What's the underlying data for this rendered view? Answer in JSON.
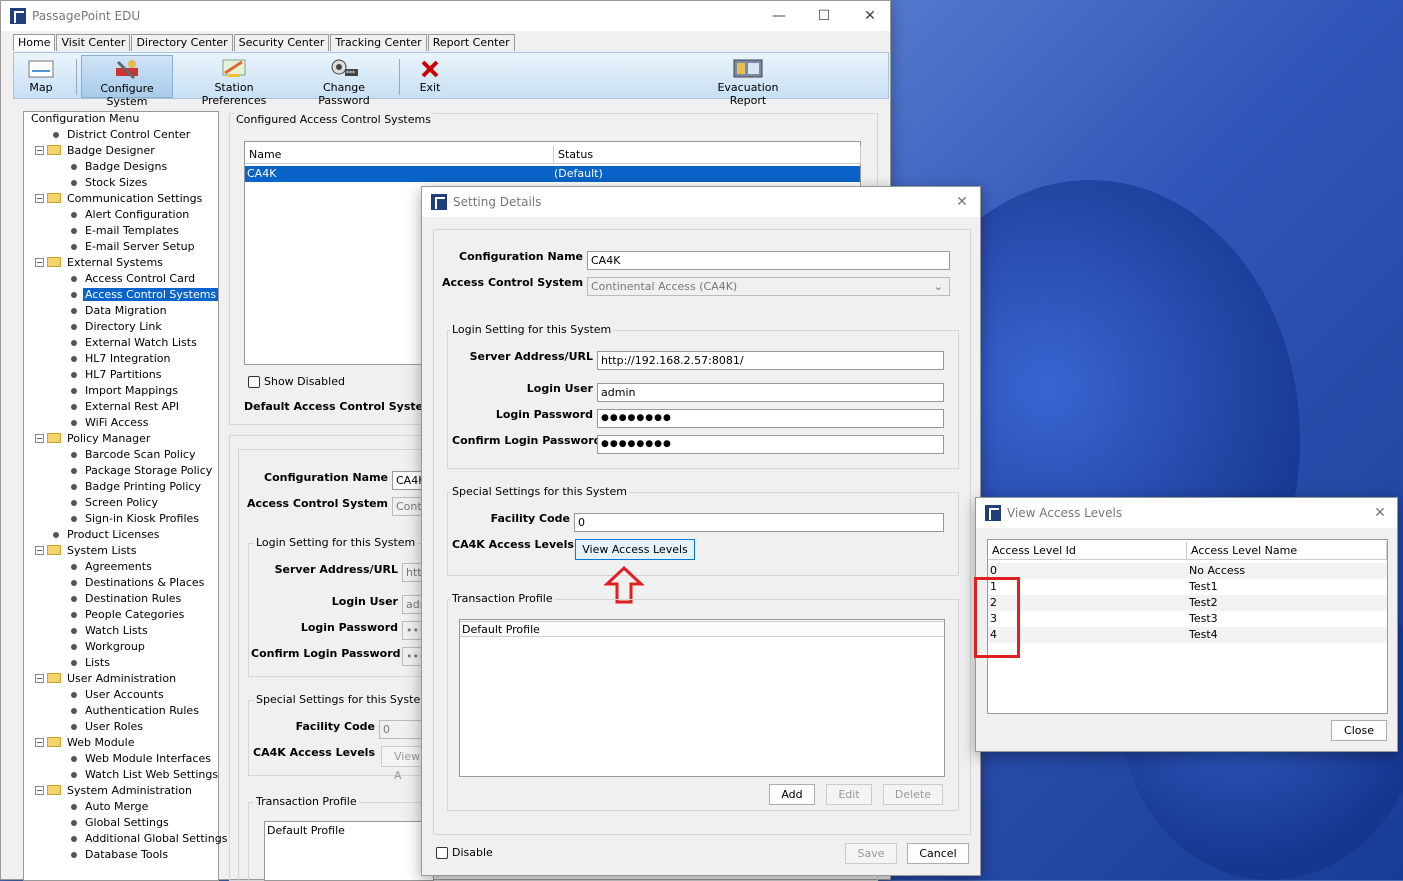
{
  "app": {
    "title": "PassagePoint EDU",
    "minimize": "—",
    "maximize": "☐",
    "close": "✕"
  },
  "tabs": [
    "Home",
    "Visit Center",
    "Directory Center",
    "Security Center",
    "Tracking Center",
    "Report Center"
  ],
  "toolbar": {
    "map": "Map",
    "configure": "Configure System",
    "station": "Station Preferences",
    "password": "Change Password",
    "exit": "Exit",
    "evacuation": "Evacuation Report"
  },
  "menu": {
    "title": "Configuration Menu",
    "items": [
      {
        "label": "District Control Center",
        "level": 1,
        "kind": "leaf"
      },
      {
        "label": "Badge Designer",
        "level": 1,
        "kind": "folder"
      },
      {
        "label": "Badge Designs",
        "level": 2,
        "kind": "leaf"
      },
      {
        "label": "Stock Sizes",
        "level": 2,
        "kind": "leaf"
      },
      {
        "label": "Communication Settings",
        "level": 1,
        "kind": "folder"
      },
      {
        "label": "Alert Configuration",
        "level": 2,
        "kind": "leaf"
      },
      {
        "label": "E-mail Templates",
        "level": 2,
        "kind": "leaf"
      },
      {
        "label": "E-mail Server Setup",
        "level": 2,
        "kind": "leaf"
      },
      {
        "label": "External Systems",
        "level": 1,
        "kind": "folder"
      },
      {
        "label": "Access Control Card",
        "level": 2,
        "kind": "leaf"
      },
      {
        "label": "Access Control Systems",
        "level": 2,
        "kind": "leaf",
        "selected": true
      },
      {
        "label": "Data Migration",
        "level": 2,
        "kind": "leaf"
      },
      {
        "label": "Directory Link",
        "level": 2,
        "kind": "leaf"
      },
      {
        "label": "External Watch Lists",
        "level": 2,
        "kind": "leaf"
      },
      {
        "label": "HL7 Integration",
        "level": 2,
        "kind": "leaf"
      },
      {
        "label": "HL7 Partitions",
        "level": 2,
        "kind": "leaf"
      },
      {
        "label": "Import Mappings",
        "level": 2,
        "kind": "leaf"
      },
      {
        "label": "External Rest API",
        "level": 2,
        "kind": "leaf"
      },
      {
        "label": "WiFi Access",
        "level": 2,
        "kind": "leaf"
      },
      {
        "label": "Policy Manager",
        "level": 1,
        "kind": "folder"
      },
      {
        "label": "Barcode Scan Policy",
        "level": 2,
        "kind": "leaf"
      },
      {
        "label": "Package Storage Policy",
        "level": 2,
        "kind": "leaf"
      },
      {
        "label": "Badge Printing Policy",
        "level": 2,
        "kind": "leaf"
      },
      {
        "label": "Screen Policy",
        "level": 2,
        "kind": "leaf"
      },
      {
        "label": "Sign-in Kiosk Profiles",
        "level": 2,
        "kind": "leaf"
      },
      {
        "label": "Product Licenses",
        "level": 1,
        "kind": "leaf"
      },
      {
        "label": "System Lists",
        "level": 1,
        "kind": "folder"
      },
      {
        "label": "Agreements",
        "level": 2,
        "kind": "leaf"
      },
      {
        "label": "Destinations & Places",
        "level": 2,
        "kind": "leaf"
      },
      {
        "label": "Destination Rules",
        "level": 2,
        "kind": "leaf"
      },
      {
        "label": "People Categories",
        "level": 2,
        "kind": "leaf"
      },
      {
        "label": "Watch Lists",
        "level": 2,
        "kind": "leaf"
      },
      {
        "label": "Workgroup",
        "level": 2,
        "kind": "leaf"
      },
      {
        "label": "Lists",
        "level": 2,
        "kind": "leaf"
      },
      {
        "label": "User Administration",
        "level": 1,
        "kind": "folder"
      },
      {
        "label": "User Accounts",
        "level": 2,
        "kind": "leaf"
      },
      {
        "label": "Authentication Rules",
        "level": 2,
        "kind": "leaf"
      },
      {
        "label": "User Roles",
        "level": 2,
        "kind": "leaf"
      },
      {
        "label": "Web Module",
        "level": 1,
        "kind": "folder"
      },
      {
        "label": "Web Module Interfaces",
        "level": 2,
        "kind": "leaf"
      },
      {
        "label": "Watch List Web Settings",
        "level": 2,
        "kind": "leaf"
      },
      {
        "label": "System Administration",
        "level": 1,
        "kind": "folder"
      },
      {
        "label": "Auto Merge",
        "level": 2,
        "kind": "leaf"
      },
      {
        "label": "Global Settings",
        "level": 2,
        "kind": "leaf"
      },
      {
        "label": "Additional Global Settings",
        "level": 2,
        "kind": "leaf"
      },
      {
        "label": "Database Tools",
        "level": 2,
        "kind": "leaf"
      }
    ]
  },
  "acs": {
    "group_title": "Configured Access Control Systems",
    "col_name": "Name",
    "col_status": "Status",
    "row_name": "CA4K",
    "row_status": "(Default)",
    "show_disabled": "Show Disabled",
    "default_label": "Default Access Control System:"
  },
  "bg_form": {
    "config_name_label": "Configuration Name",
    "config_name_value": "CA4K",
    "acs_label": "Access Control System",
    "acs_value": "Conti",
    "login_group": "Login Setting for this System",
    "server_label": "Server Address/URL",
    "server_value": "http",
    "user_label": "Login User",
    "user_value": "adm",
    "pwd_label": "Login Password",
    "pwd_value": "•••",
    "cpwd_label": "Confirm Login Password",
    "cpwd_value": "•••",
    "special_group": "Special Settings for this System",
    "facility_label": "Facility Code",
    "facility_value": "0",
    "levels_label": "CA4K Access Levels",
    "levels_btn": "View A",
    "profile_group": "Transaction Profile",
    "profile_item": "Default Profile"
  },
  "details": {
    "title": "Setting Details",
    "config_name_label": "Configuration Name",
    "config_name_value": "CA4K",
    "acs_label": "Access Control System",
    "acs_value": "Continental Access (CA4K)",
    "login_group": "Login Setting for this System",
    "server_label": "Server Address/URL",
    "server_value": "http://192.168.2.57:8081/",
    "user_label": "Login User",
    "user_value": "admin",
    "pwd_label": "Login Password",
    "pwd_value": "●●●●●●●●",
    "cpwd_label": "Confirm Login Password",
    "cpwd_value": "●●●●●●●●",
    "special_group": "Special Settings for this System",
    "facility_label": "Facility Code",
    "facility_value": "0",
    "levels_label": "CA4K Access Levels",
    "levels_btn": "View Access Levels",
    "profile_group": "Transaction Profile",
    "profile_item": "Default Profile",
    "add": "Add",
    "edit": "Edit",
    "delete": "Delete",
    "disable": "Disable",
    "save": "Save",
    "cancel": "Cancel"
  },
  "levels": {
    "title": "View Access Levels",
    "col_id": "Access Level Id",
    "col_name": "Access Level Name",
    "rows": [
      {
        "id": "0",
        "name": "No Access"
      },
      {
        "id": "1",
        "name": "Test1"
      },
      {
        "id": "2",
        "name": "Test2"
      },
      {
        "id": "3",
        "name": "Test3"
      },
      {
        "id": "4",
        "name": "Test4"
      }
    ],
    "close": "Close"
  },
  "colors": {
    "selection": "#0a63c8",
    "highlight": "#e02020",
    "toolbar": "#c8e0f4"
  }
}
